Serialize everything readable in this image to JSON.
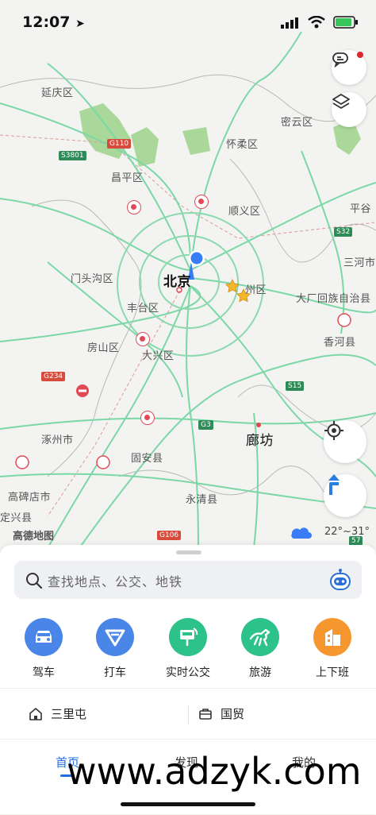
{
  "status_bar": {
    "time": "12:07"
  },
  "map": {
    "labels": [
      {
        "text": "延庆区",
        "size": "normal"
      },
      {
        "text": "密云区",
        "size": "normal"
      },
      {
        "text": "怀柔区",
        "size": "normal"
      },
      {
        "text": "昌平区",
        "size": "normal"
      },
      {
        "text": "顺义区",
        "size": "normal"
      },
      {
        "text": "平谷",
        "size": "normal"
      },
      {
        "text": "门头沟区",
        "size": "normal"
      },
      {
        "text": "北京",
        "size": "big"
      },
      {
        "text": "州区",
        "size": "normal"
      },
      {
        "text": "三河市",
        "size": "normal"
      },
      {
        "text": "丰台区",
        "size": "normal"
      },
      {
        "text": "大厂回族自治县",
        "size": "normal"
      },
      {
        "text": "房山区",
        "size": "normal"
      },
      {
        "text": "大兴区",
        "size": "normal"
      },
      {
        "text": "香河县",
        "size": "normal"
      },
      {
        "text": "涿州市",
        "size": "normal"
      },
      {
        "text": "廊坊",
        "size": "big"
      },
      {
        "text": "固安县",
        "size": "normal"
      },
      {
        "text": "高碑店市",
        "size": "normal"
      },
      {
        "text": "永清县",
        "size": "normal"
      },
      {
        "text": "定兴县",
        "size": "normal"
      }
    ],
    "shields": [
      {
        "text": "G110",
        "color": "red"
      },
      {
        "text": "S3801",
        "color": "green"
      },
      {
        "text": "S32",
        "color": "green"
      },
      {
        "text": "G234",
        "color": "red"
      },
      {
        "text": "S15",
        "color": "green"
      },
      {
        "text": "G3",
        "color": "green"
      },
      {
        "text": "G106",
        "color": "red"
      },
      {
        "text": "57",
        "color": "green"
      }
    ],
    "logo": "高德地图",
    "weather": "22°~31°",
    "colors": {
      "road": "#5fcf92",
      "location": "#3a7cf5",
      "poi": "#e04a56",
      "star": "#f5b72a"
    }
  },
  "search": {
    "placeholder": "查找地点、公交、地铁"
  },
  "quick_actions": [
    {
      "label": "驾车",
      "icon": "car-icon",
      "color": "#4a86e8"
    },
    {
      "label": "打车",
      "icon": "taxi-icon",
      "color": "#4a86e8"
    },
    {
      "label": "实时公交",
      "icon": "bus-stop-icon",
      "color": "#2cc28a"
    },
    {
      "label": "旅游",
      "icon": "horse-icon",
      "color": "#2cc28a"
    },
    {
      "label": "上下班",
      "icon": "office-icon",
      "color": "#f5972e"
    }
  ],
  "favorites": [
    {
      "label": "三里屯",
      "icon": "home-icon"
    },
    {
      "label": "国贸",
      "icon": "briefcase-icon"
    }
  ],
  "tabs": [
    {
      "label": "首页",
      "active": true
    },
    {
      "label": "发现",
      "active": false
    },
    {
      "label": "我的",
      "active": false
    }
  ],
  "watermark": "www.adzyk.com"
}
